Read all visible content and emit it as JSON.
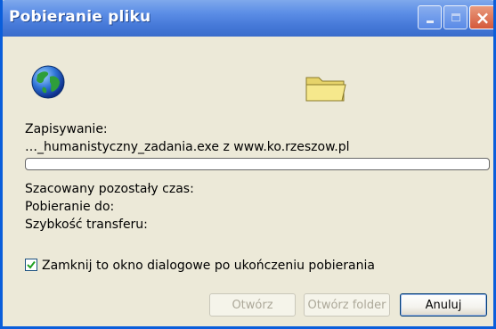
{
  "window": {
    "title": "Pobieranie pliku"
  },
  "titlebar_buttons": {
    "minimize": "minimize-icon",
    "maximize": "maximize-icon",
    "close": "close-icon"
  },
  "icons": {
    "source": "globe-icon",
    "destination": "folder-icon"
  },
  "status": {
    "saving_label": "Zapisywanie:",
    "file_line": "…_humanistyczny_zadania.exe z www.ko.rzeszow.pl",
    "progress_fraction": 0.0,
    "time_remaining_label": "Szacowany pozostały czas:",
    "download_to_label": "Pobieranie do:",
    "transfer_speed_label": "Szybkość transferu:"
  },
  "options": {
    "close_when_done_label": "Zamknij to okno dialogowe po ukończeniu pobierania",
    "close_when_done_checked": true
  },
  "buttons": {
    "open_label": "Otwórz",
    "open_folder_label": "Otwórz folder",
    "cancel_label": "Anuluj"
  },
  "colors": {
    "title_bar": "#4679D8",
    "window_bg": "#ECE9D8",
    "close_button": "#D4583A",
    "checkmark": "#21A121",
    "progress": "#2FB52F"
  }
}
